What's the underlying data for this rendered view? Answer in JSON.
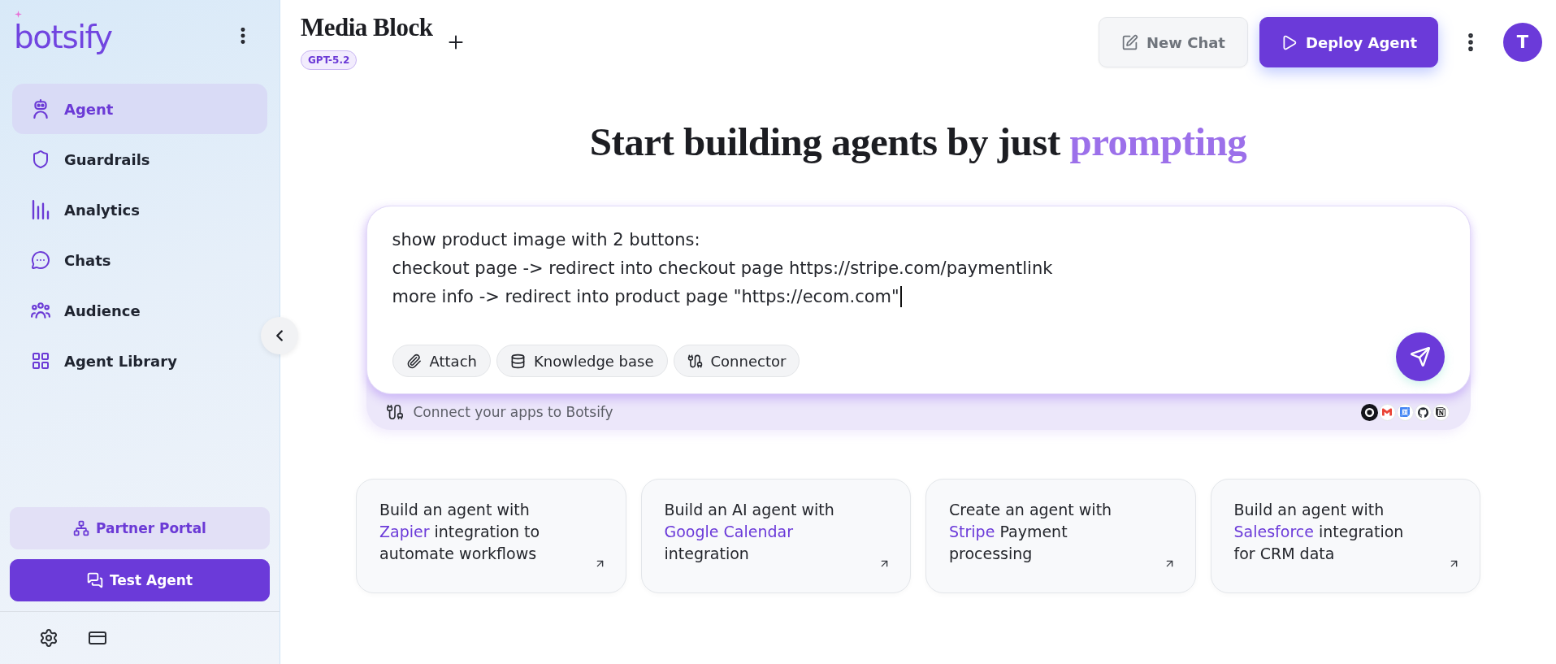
{
  "sidebar": {
    "logo": "botsify",
    "nav_items": [
      {
        "label": "Agent",
        "selected": true
      },
      {
        "label": "Guardrails",
        "selected": false
      },
      {
        "label": "Analytics",
        "selected": false
      },
      {
        "label": "Chats",
        "selected": false
      },
      {
        "label": "Audience",
        "selected": false
      },
      {
        "label": "Agent Library",
        "selected": false
      }
    ],
    "buttons": [
      {
        "label": "Partner Portal",
        "kind": "secondary"
      },
      {
        "label": "Test Agent",
        "kind": "primary"
      }
    ]
  },
  "header": {
    "title": "Media Block",
    "model_badge": "GPT-5.2",
    "buttons": [
      {
        "label": "New Chat",
        "kind": "secondary"
      },
      {
        "label": "Deploy Agent",
        "kind": "primary"
      }
    ],
    "avatar": "T"
  },
  "hero": {
    "heading": "Start building agents by just",
    "heading_highlight": "prompting"
  },
  "prompt": {
    "value": "show product image with 2 buttons:\ncheckout page -> redirect into checkout page https://stripe.com/paymentlink\nmore info -> redirect into product page \"https://ecom.com\"",
    "focused": true,
    "chips": [
      "Attach",
      "Knowledge base",
      "Connector"
    ],
    "connect_hint": "Connect your apps to Botsify"
  },
  "suggestions": [
    {
      "before": "Build an agent with",
      "highlight": "Zapier",
      "after": "integration to automate workflows"
    },
    {
      "before": "Build an AI agent with",
      "highlight": "Google Calendar",
      "after": "integration"
    },
    {
      "before": "Create an agent with",
      "highlight": "Stripe",
      "after": "Payment processing"
    },
    {
      "before": "Build an agent with",
      "highlight": "Salesforce",
      "after": "integration for CRM data"
    }
  ]
}
